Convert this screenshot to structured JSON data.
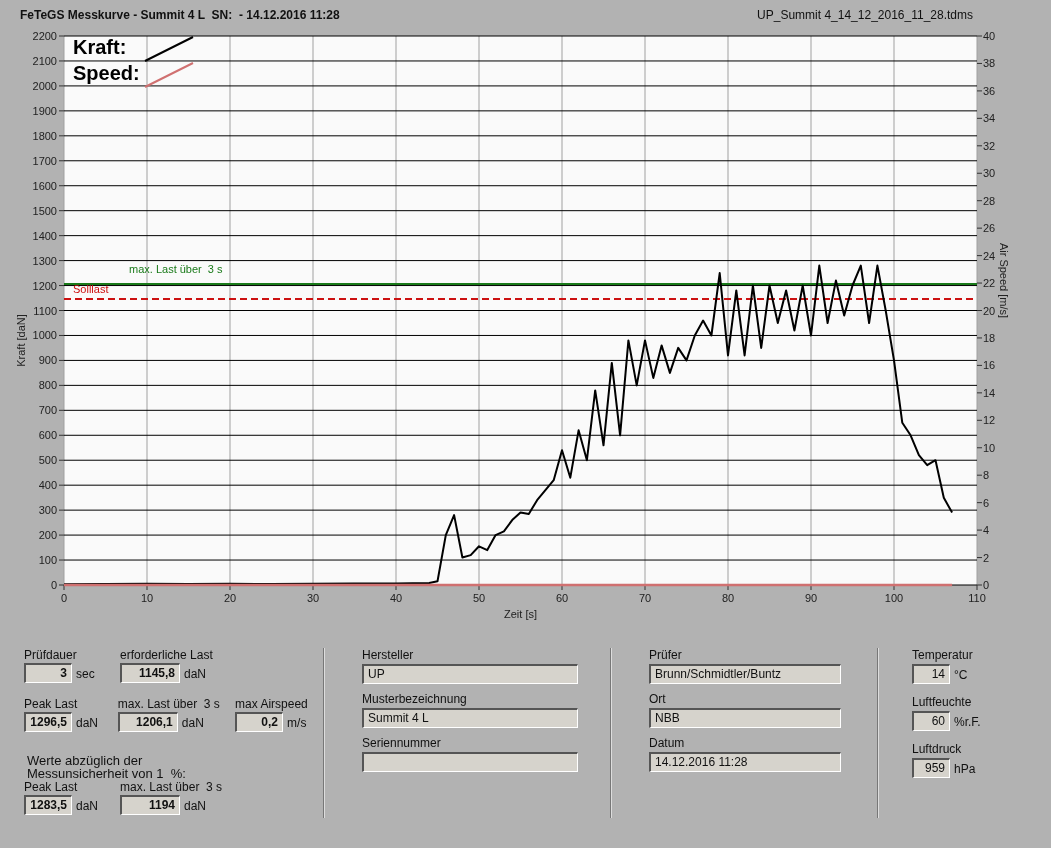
{
  "header": {
    "title": "FeTeGS Messkurve - Summit 4 L  SN:  - 14.12.2016 11:28",
    "file": "UP_Summit 4_14_12_2016_11_28.tdms"
  },
  "chart": {
    "chart_data": {
      "type": "line",
      "xlabel": "Zeit [s]",
      "ylabel": "Kraft [daN]",
      "y2label": "Air Speed [m/s]",
      "x": [
        0,
        5,
        10,
        15,
        20,
        25,
        30,
        35,
        40,
        44,
        45,
        46,
        47,
        48,
        49,
        50,
        51,
        52,
        53,
        54,
        55,
        56,
        57,
        58,
        59,
        60,
        61,
        62,
        63,
        64,
        65,
        66,
        67,
        68,
        69,
        70,
        71,
        72,
        73,
        74,
        75,
        76,
        77,
        78,
        79,
        80,
        81,
        82,
        83,
        84,
        85,
        86,
        87,
        88,
        89,
        90,
        91,
        92,
        93,
        94,
        95,
        96,
        97,
        98,
        99,
        100,
        101,
        102,
        103,
        104,
        105,
        106,
        107,
        110
      ],
      "xlim": [
        0,
        110
      ],
      "ylim": [
        0,
        2200
      ],
      "y2lim": [
        0,
        40
      ],
      "xticks": [
        0,
        10,
        20,
        30,
        40,
        50,
        60,
        70,
        80,
        90,
        100,
        110
      ],
      "yticks": [
        0,
        100,
        200,
        300,
        400,
        500,
        600,
        700,
        800,
        900,
        1000,
        1100,
        1200,
        1300,
        1400,
        1500,
        1600,
        1700,
        1800,
        1900,
        2000,
        2100,
        2200
      ],
      "y2ticks": [
        0,
        2,
        4,
        6,
        8,
        10,
        12,
        14,
        16,
        18,
        20,
        22,
        24,
        26,
        28,
        30,
        32,
        34,
        36,
        38,
        40
      ],
      "series": [
        {
          "name": "Kraft:",
          "color": "#000000",
          "values": [
            3,
            4,
            5,
            4,
            5,
            4,
            5,
            6,
            6,
            8,
            15,
            200,
            280,
            110,
            120,
            155,
            140,
            200,
            215,
            260,
            290,
            285,
            340,
            380,
            420,
            540,
            430,
            620,
            500,
            780,
            560,
            890,
            600,
            980,
            800,
            980,
            830,
            960,
            850,
            950,
            900,
            1000,
            1060,
            1000,
            1250,
            920,
            1180,
            920,
            1200,
            950,
            1200,
            1050,
            1180,
            1020,
            1200,
            1000,
            1280,
            1050,
            1220,
            1080,
            1200,
            1280,
            1050,
            1280,
            1100,
            900,
            650,
            600,
            520,
            480,
            500,
            350,
            290,
            null
          ]
        },
        {
          "name": "Speed:",
          "color": "#d07070",
          "axis": "y2",
          "values": [
            0,
            0,
            0,
            0,
            0,
            0,
            0,
            0,
            0,
            0,
            0,
            0,
            0,
            0,
            0,
            0,
            0,
            0,
            0,
            0,
            0,
            0,
            0,
            0,
            0,
            0,
            0,
            0,
            0,
            0,
            0,
            0,
            0,
            0,
            0,
            0,
            0,
            0,
            0,
            0,
            0,
            0,
            0,
            0,
            0,
            0,
            0,
            0,
            0,
            0,
            0,
            0,
            0,
            0,
            0,
            0,
            0,
            0,
            0,
            0,
            0,
            0,
            0,
            0,
            0,
            0,
            0,
            0,
            0,
            0,
            0,
            0,
            0,
            null
          ]
        },
        {
          "name": "max. Last über  3 s",
          "color": "#1a7a1a",
          "values": [
            1206.1,
            1206.1,
            1206.1,
            1206.1,
            1206.1,
            1206.1,
            1206.1,
            1206.1,
            1206.1,
            1206.1,
            1206.1,
            1206.1,
            1206.1,
            1206.1,
            1206.1,
            1206.1,
            1206.1,
            1206.1,
            1206.1,
            1206.1,
            1206.1,
            1206.1,
            1206.1,
            1206.1,
            1206.1,
            1206.1,
            1206.1,
            1206.1,
            1206.1,
            1206.1,
            1206.1,
            1206.1,
            1206.1,
            1206.1,
            1206.1,
            1206.1,
            1206.1,
            1206.1,
            1206.1,
            1206.1,
            1206.1,
            1206.1,
            1206.1,
            1206.1,
            1206.1,
            1206.1,
            1206.1,
            1206.1,
            1206.1,
            1206.1,
            1206.1,
            1206.1,
            1206.1,
            1206.1,
            1206.1,
            1206.1,
            1206.1,
            1206.1,
            1206.1,
            1206.1,
            1206.1,
            1206.1,
            1206.1,
            1206.1,
            1206.1,
            1206.1,
            1206.1,
            1206.1,
            1206.1,
            1206.1,
            1206.1,
            1206.1,
            1206.1,
            1206.1
          ]
        },
        {
          "name": "Solllast",
          "color": "#cc1111",
          "line_style": "dashed",
          "values": [
            1145.8,
            1145.8,
            1145.8,
            1145.8,
            1145.8,
            1145.8,
            1145.8,
            1145.8,
            1145.8,
            1145.8,
            1145.8,
            1145.8,
            1145.8,
            1145.8,
            1145.8,
            1145.8,
            1145.8,
            1145.8,
            1145.8,
            1145.8,
            1145.8,
            1145.8,
            1145.8,
            1145.8,
            1145.8,
            1145.8,
            1145.8,
            1145.8,
            1145.8,
            1145.8,
            1145.8,
            1145.8,
            1145.8,
            1145.8,
            1145.8,
            1145.8,
            1145.8,
            1145.8,
            1145.8,
            1145.8,
            1145.8,
            1145.8,
            1145.8,
            1145.8,
            1145.8,
            1145.8,
            1145.8,
            1145.8,
            1145.8,
            1145.8,
            1145.8,
            1145.8,
            1145.8,
            1145.8,
            1145.8,
            1145.8,
            1145.8,
            1145.8,
            1145.8,
            1145.8,
            1145.8,
            1145.8,
            1145.8,
            1145.8,
            1145.8,
            1145.8,
            1145.8,
            1145.8,
            1145.8,
            1145.8,
            1145.8,
            1145.8,
            1145.8,
            1145.8
          ]
        }
      ],
      "grid": true,
      "legend": "upper left"
    }
  },
  "results": {
    "rows": [
      [
        {
          "label": "Prüfdauer",
          "value": "3",
          "unit": "sec"
        },
        {
          "label": "erforderliche Last",
          "value": "1145,8",
          "unit": "daN"
        }
      ],
      [
        {
          "label": "Peak Last",
          "value": "1296,5",
          "unit": "daN"
        },
        {
          "label": "max. Last über  3 s",
          "value": "1206,1",
          "unit": "daN"
        },
        {
          "label": "max Airspeed",
          "value": "0,2",
          "unit": "m/s"
        }
      ]
    ],
    "note": [
      "Werte abzüglich der",
      "Messunsicherheit von 1  %:"
    ],
    "corrected": [
      {
        "label": "Peak Last",
        "value": "1283,5",
        "unit": "daN"
      },
      {
        "label": "max. Last über  3 s",
        "value": "1194",
        "unit": "daN"
      }
    ]
  },
  "specimen": [
    {
      "label": "Hersteller",
      "value": "UP"
    },
    {
      "label": "Musterbezeichnung",
      "value": "Summit 4 L"
    },
    {
      "label": "Seriennummer"
    }
  ],
  "test": [
    {
      "label": "Prüfer",
      "value": "Brunn/Schmidtler/Buntz"
    },
    {
      "label": "Ort",
      "value": "NBB"
    },
    {
      "label": "Datum",
      "value": "14.12.2016 11:28"
    }
  ],
  "conditions": [
    {
      "label": "Temperatur",
      "value": "14",
      "unit": "°C"
    },
    {
      "label": "Luftfeuchte",
      "value": "60",
      "unit": "%r.F."
    },
    {
      "label": "Luftdruck",
      "value": "959",
      "unit": "hPa"
    }
  ]
}
